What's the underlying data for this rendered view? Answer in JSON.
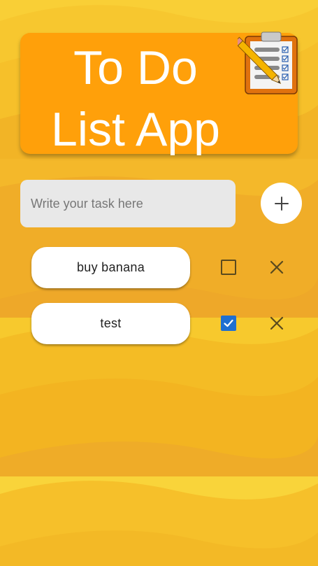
{
  "header": {
    "title": "To Do List App",
    "icon": "clipboard-checklist-pencil-icon"
  },
  "new_task": {
    "placeholder": "Write your task here",
    "value": "",
    "add_icon": "plus-icon"
  },
  "tasks": [
    {
      "text": "buy banana",
      "done": false,
      "delete_icon": "close-icon"
    },
    {
      "text": "test",
      "done": true,
      "delete_icon": "close-icon"
    }
  ],
  "colors": {
    "background": "#f4b820",
    "header": "#ffa00a",
    "input": "#e8e8e8",
    "checkbox_checked": "#1f6fd1"
  }
}
